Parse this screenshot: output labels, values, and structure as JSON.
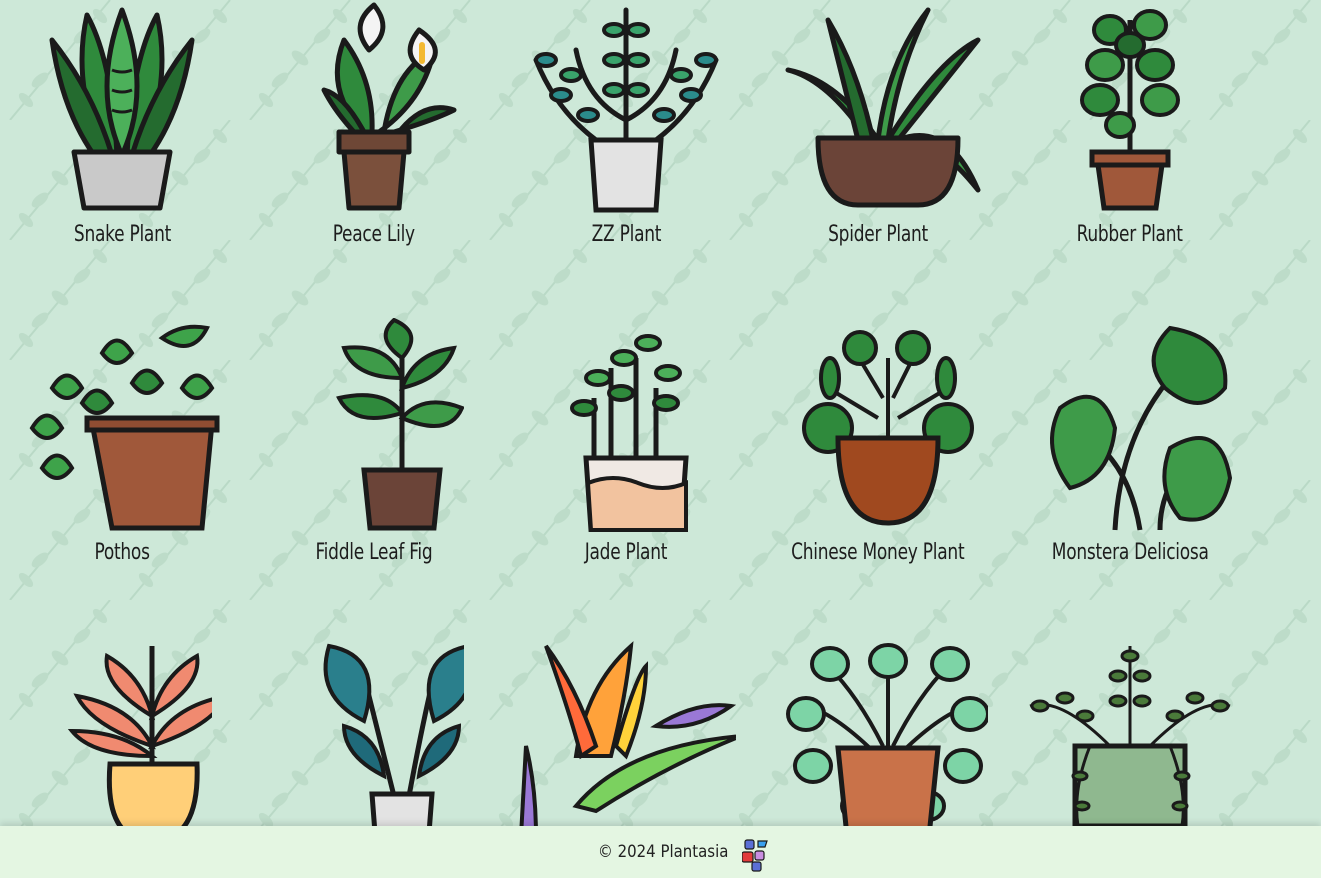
{
  "plants": [
    {
      "name": "Snake Plant",
      "icon": "snake-plant-icon"
    },
    {
      "name": "Peace Lily",
      "icon": "peace-lily-icon"
    },
    {
      "name": "ZZ Plant",
      "icon": "zz-plant-icon"
    },
    {
      "name": "Spider Plant",
      "icon": "spider-plant-icon"
    },
    {
      "name": "Rubber Plant",
      "icon": "rubber-plant-icon"
    },
    {
      "name": "Pothos",
      "icon": "pothos-icon"
    },
    {
      "name": "Fiddle Leaf Fig",
      "icon": "fiddle-leaf-fig-icon"
    },
    {
      "name": "Jade Plant",
      "icon": "jade-plant-icon"
    },
    {
      "name": "Chinese Money Plant",
      "icon": "chinese-money-plant-icon"
    },
    {
      "name": "Monstera Deliciosa",
      "icon": "monstera-icon"
    },
    {
      "name": "",
      "icon": "calathea-red-icon"
    },
    {
      "name": "",
      "icon": "calathea-blue-icon"
    },
    {
      "name": "",
      "icon": "bird-of-paradise-icon"
    },
    {
      "name": "",
      "icon": "pilea-mint-icon"
    },
    {
      "name": "",
      "icon": "trailing-vine-icon"
    }
  ],
  "footer": {
    "copyright": "© 2024 Plantasia",
    "social_icon": "social-media-icon"
  },
  "colors": {
    "background": "#cde8d8",
    "footer": "#e4f6e2",
    "outline": "#1a1a1a"
  }
}
